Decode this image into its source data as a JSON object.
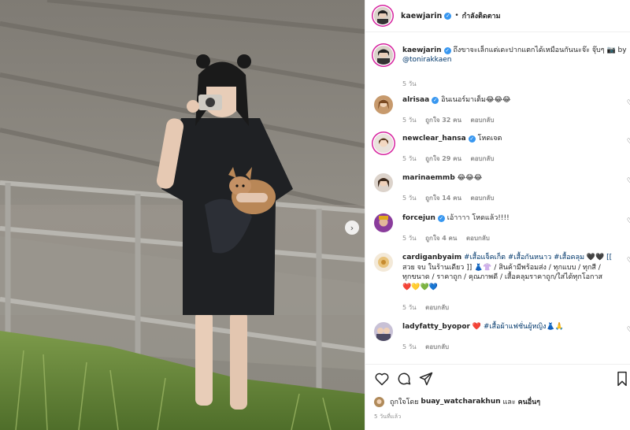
{
  "post": {
    "author": "kaewjarin",
    "follow_state": "กำลังติดตาม",
    "separator": "•",
    "caption_text": "ถึงขาจะเล็กแต่เดะปากแตกได้เหมือนกันนะจ๊ะ จุ๊บๆ 📷 by",
    "caption_mention": "@tonirakkaen",
    "caption_time": "5 วัน"
  },
  "comments": [
    {
      "user": "alrisaa",
      "verified": true,
      "text": "อินเนอร์มาเต็ม",
      "emojis": [
        "😂",
        "😂",
        "😂"
      ],
      "time": "5 วัน",
      "likes": "ถูกใจ 32 คน",
      "reply": "ตอบกลับ"
    },
    {
      "user": "newclear_hansa",
      "verified": true,
      "text": "โหดเจต",
      "emojis": [],
      "time": "5 วัน",
      "likes": "ถูกใจ 29 คน",
      "reply": "ตอบกลับ"
    },
    {
      "user": "marinaemmb",
      "verified": false,
      "text": "",
      "emojis": [
        "😂",
        "😂",
        "😂"
      ],
      "time": "5 วัน",
      "likes": "ถูกใจ 14 คน",
      "reply": "ตอบกลับ"
    },
    {
      "user": "forcejun",
      "verified": true,
      "text": "เอ้าาาา โหดแล้ว!!!!",
      "emojis": [],
      "time": "5 วัน",
      "likes": "ถูกใจ 4 คน",
      "reply": "ตอบกลับ"
    },
    {
      "user": "cardiganbyaim",
      "verified": false,
      "line1": "#เสื้อแจ็คเก็ต #เสื้อกันหนาว #เสื้อคลุม 🖤🖤 [[",
      "line2": "สวย จบ ในร้านเดียว ]] 👗👚 / สินค้ามีพร้อมส่ง / ทุกแบบ / ทุกสี /",
      "line3": "ทุกขนาด / ราคาถูก / คุณภาพดี / เสื้อคลุมราคาถูก/ใส่ได้ทุกโอกาส",
      "line4_emojis": [
        "❤️",
        "💛",
        "💚",
        "💙"
      ],
      "time": "5 วัน",
      "reply": "ตอบกลับ"
    },
    {
      "user": "ladyfatty_byopor",
      "verified": false,
      "text": "❤️ #เสื้อผ้าแฟชั่นผู้หญิง👗🙏",
      "emojis": [],
      "time": "5 วัน",
      "reply": "ตอบกลับ"
    }
  ],
  "footer": {
    "liked_by_prefix": "ถูกใจโดย",
    "liked_by_user": "buay_watcharakhun",
    "liked_by_and": "และ",
    "liked_by_others": "คนอื่นๆ",
    "post_age": "5 วันที่แล้ว"
  },
  "icons": {
    "like": "heart-outline-icon",
    "comment": "comment-bubble-icon",
    "share": "paper-plane-icon",
    "save": "bookmark-icon",
    "next": "chevron-right-icon",
    "verified": "verified-badge-icon"
  },
  "colors": {
    "verified": "#3897f0",
    "mention": "#00376b",
    "meta": "#8e8e8e",
    "story_ring": "#d6249f"
  }
}
